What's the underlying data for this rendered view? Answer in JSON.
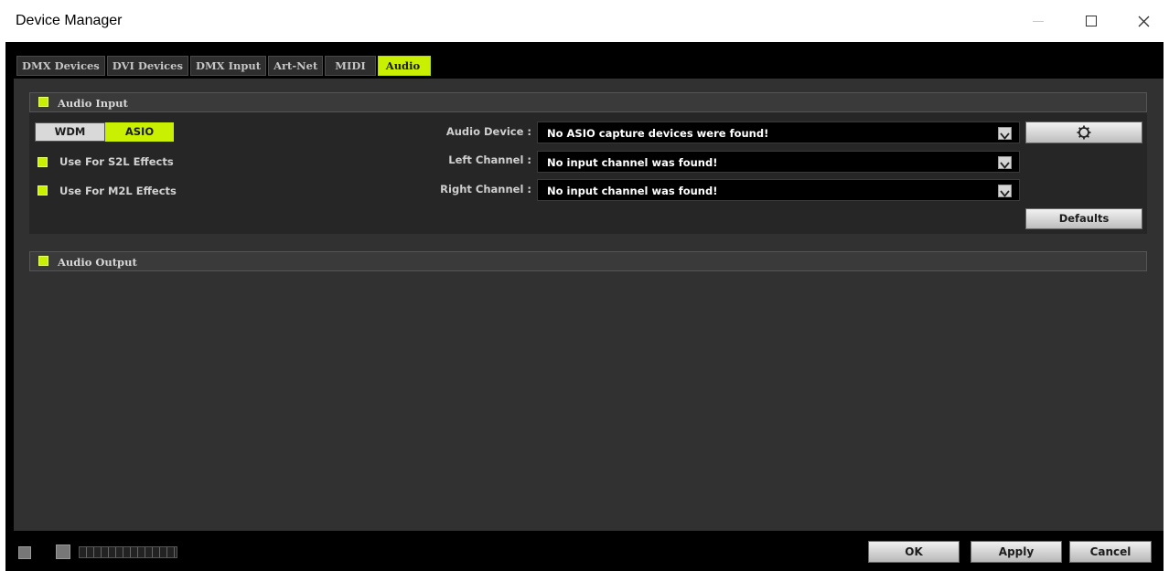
{
  "window": {
    "title": "Device Manager",
    "controls": [
      "minimize",
      "maximize",
      "close"
    ]
  },
  "tabs": [
    {
      "label": "DMX Devices",
      "active": false
    },
    {
      "label": "DVI Devices",
      "active": false
    },
    {
      "label": "DMX Input",
      "active": false
    },
    {
      "label": "Art-Net",
      "active": false
    },
    {
      "label": "MIDI",
      "active": false
    },
    {
      "label": "Audio",
      "active": true
    }
  ],
  "audio_input": {
    "title": "Audio Input",
    "enabled": true,
    "mode_buttons": [
      {
        "label": "WDM",
        "selected": false
      },
      {
        "label": "ASIO",
        "selected": true
      }
    ],
    "options": [
      {
        "label": "Use For S2L Effects",
        "checked": true
      },
      {
        "label": "Use For M2L Effects",
        "checked": true
      }
    ],
    "fields": [
      {
        "label": "Audio Device :",
        "value": "No ASIO capture devices were found!"
      },
      {
        "label": "Left Channel :",
        "value": "No input channel was found!"
      },
      {
        "label": "Right Channel :",
        "value": "No input channel was found!"
      }
    ],
    "settings_icon": "gear-icon",
    "defaults_label": "Defaults"
  },
  "audio_output": {
    "title": "Audio Output",
    "enabled": true
  },
  "footer": {
    "ok_label": "OK",
    "apply_label": "Apply",
    "cancel_label": "Cancel"
  },
  "colors": {
    "accent": "#c8f000",
    "background": "#313131",
    "field_bg": "#000000"
  }
}
